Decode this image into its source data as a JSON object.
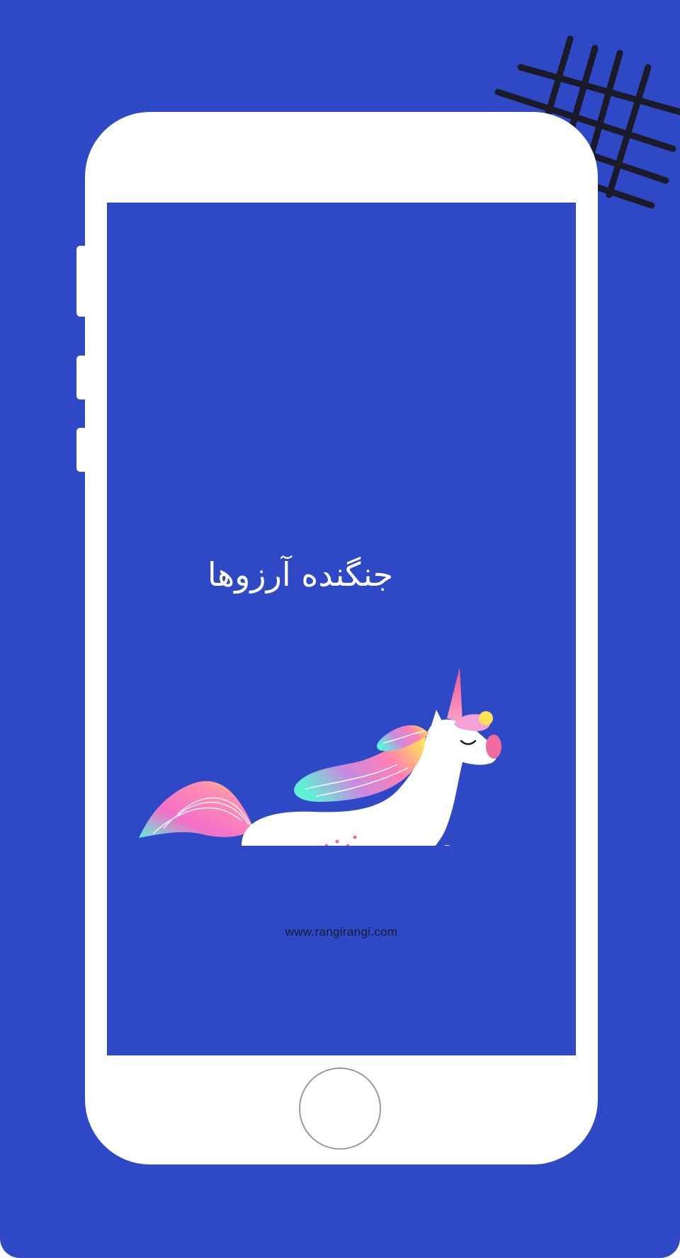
{
  "app": {
    "title": "جنگنده آرزوها",
    "website": "www.rangirangi.com"
  },
  "colors": {
    "background": "#2f48c6",
    "screen": "#2f48c6",
    "phone_body": "#ffffff",
    "hash_pattern": "#1a1a28",
    "hoof": "#f06aa0"
  },
  "icons": {
    "decoration": "hash-grid-icon",
    "illustration": "unicorn-icon",
    "home": "home-button-icon"
  }
}
